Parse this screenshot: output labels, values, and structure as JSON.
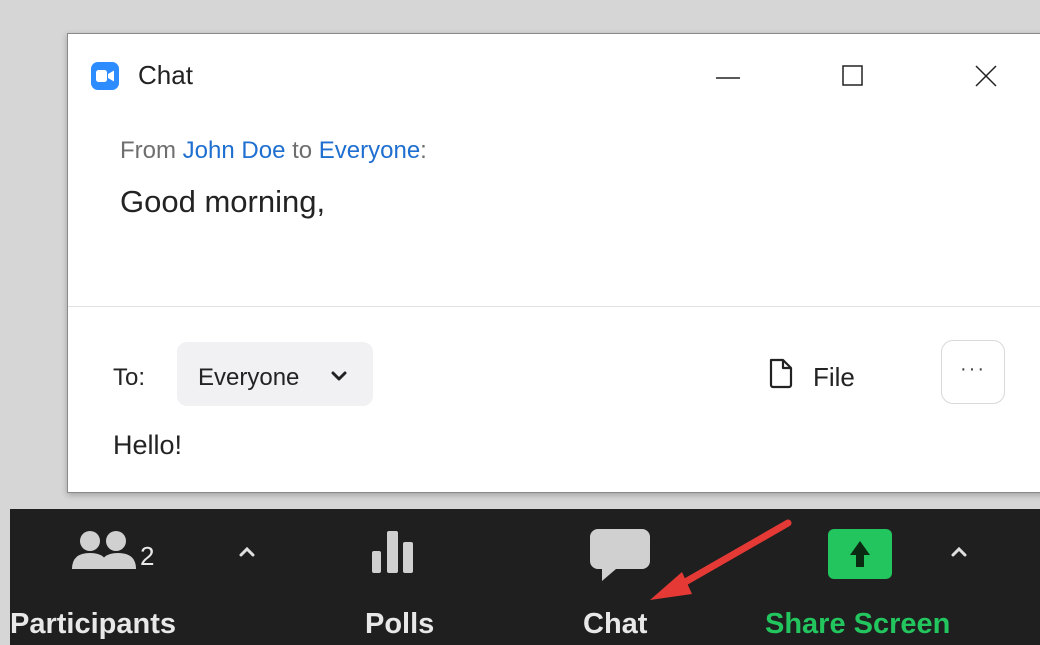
{
  "window": {
    "title": "Chat",
    "app_icon": "zoom-video-camera-icon",
    "accent_color": "#2d8cff"
  },
  "message": {
    "from_prefix": "From",
    "sender": "John Doe",
    "to_word": "to",
    "recipient": "Everyone",
    "colon": ":",
    "text": "Good morning,"
  },
  "composer": {
    "to_label": "To:",
    "recipient_selected": "Everyone",
    "file_label": "File",
    "more_label": "···",
    "input_value": "Hello!"
  },
  "toolbar": {
    "participants_label": "Participants",
    "participants_count": "2",
    "polls_label": "Polls",
    "chat_label": "Chat",
    "share_label": "Share Screen",
    "share_color": "#22c55e",
    "background": "#1f1f1f"
  },
  "annotation": {
    "arrow_color": "#e53935",
    "points_to": "Chat"
  }
}
